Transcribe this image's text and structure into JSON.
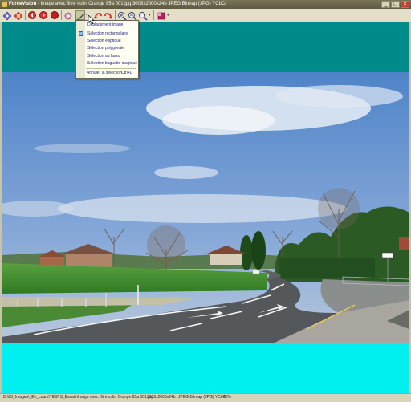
{
  "window": {
    "app_name": "ForceVision",
    "title_rest": " - Image avec filtre colin Orange 85a 001.jpg   3008x2000x24b   JPEG Bitmap (JPG) YCbCr",
    "minimize": "_",
    "maximize": "□",
    "close": "×"
  },
  "menu": {
    "items": [
      {
        "label": "Déplacement image",
        "checked": false
      },
      {
        "label": "Sélection rectangulaire",
        "checked": true
      },
      {
        "label": "Sélection elliptique",
        "checked": false
      },
      {
        "label": "Sélection polygonale",
        "checked": false
      },
      {
        "label": "Sélection au lasso",
        "checked": false
      },
      {
        "label": "Sélection baguette magique",
        "checked": false
      }
    ],
    "cancel": {
      "label": "Annuler la sélection",
      "shortcut": "Ctrl+D"
    }
  },
  "status": {
    "path": "D:\\08_Images\\_En_cours\\TESTS_Essais\\Image avec filtre colin Orange 85a 001.jpg",
    "dimensions": "3008x2000x24b",
    "format": "JPEG Bitmap (JPG) YCbCr",
    "zoom": "40%"
  },
  "colors": {
    "top_band": "#008b8b",
    "bottom_band": "#00f0f0",
    "sky": "#5d8fcf"
  },
  "icons": [
    "open-icon",
    "save-icon",
    "back-icon",
    "forward-icon",
    "record-icon",
    "settings-icon",
    "selection-tool-icon",
    "undo-icon",
    "redo-icon",
    "zoom-in-icon",
    "zoom-out-icon",
    "zoom-icon",
    "color-icon"
  ]
}
